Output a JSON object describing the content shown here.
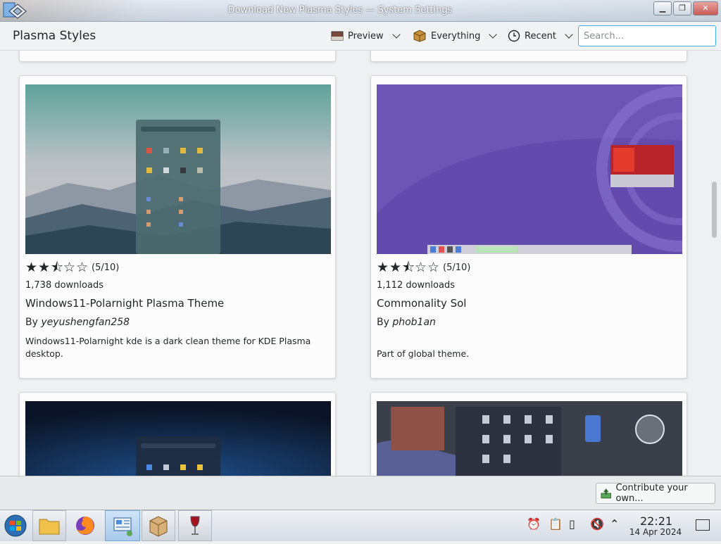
{
  "window": {
    "title": "Download New Plasma Styles — System Settings",
    "minimize_icon": "minimize-icon",
    "maximize_icon": "maximize-icon",
    "close_icon": "close-icon"
  },
  "header": {
    "title": "Plasma Styles",
    "preview_label": "Preview",
    "everything_label": "Everything",
    "recent_label": "Recent",
    "search_placeholder": "Search...",
    "search_value": ""
  },
  "cards": [
    {
      "rating_value": 5,
      "rating_max": 10,
      "rating_text": "(5/10)",
      "downloads": "1,738 downloads",
      "name": "Windows11-Polarnight Plasma Theme",
      "by": "By",
      "author": "yeyushengfan258",
      "description": "Windows11-Polarnight kde is a dark clean theme for KDE Plasma desktop."
    },
    {
      "rating_value": 5,
      "rating_max": 10,
      "rating_text": "(5/10)",
      "downloads": "1,112 downloads",
      "name": "Commonality Sol",
      "by": "By",
      "author": "phob1an",
      "description": "Part of global theme."
    }
  ],
  "footer": {
    "contribute_label": "Contribute your own..."
  },
  "taskbar": {
    "time": "22:21",
    "date": "14 Apr 2024"
  },
  "colors": {
    "accent": "#3daee9",
    "card_bg": "#fcfcfc",
    "page_bg": "#eff0f1",
    "thumb1_sky": "#5c9c94",
    "thumb2_bg": "#6b55b5"
  }
}
